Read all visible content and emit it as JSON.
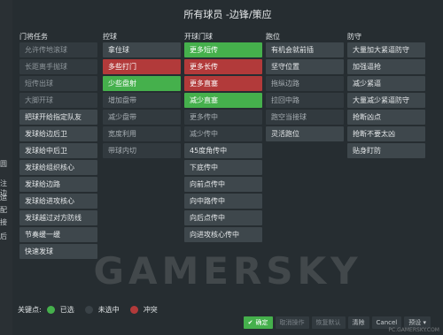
{
  "title": "所有球员 -边锋/策应",
  "left_fragments": [
    "圆",
    "注边",
    "运",
    "配",
    "接",
    "后"
  ],
  "columns": [
    {
      "header": "门将任务",
      "items": [
        {
          "label": "允许传地滚球",
          "state": "off"
        },
        {
          "label": "长距离手抛球",
          "state": "off"
        },
        {
          "label": "短传出球",
          "state": "off"
        },
        {
          "label": "大脚开球",
          "state": "off"
        },
        {
          "label": "把球开给指定队友",
          "state": "on"
        },
        {
          "label": "发球给边后卫",
          "state": "on"
        },
        {
          "label": "发球给中后卫",
          "state": "on"
        },
        {
          "label": "发球给组织核心",
          "state": "on"
        },
        {
          "label": "发球给边路",
          "state": "on"
        },
        {
          "label": "发球给进攻核心",
          "state": "on"
        },
        {
          "label": "发球越过对方防线",
          "state": "on"
        },
        {
          "label": "节奏缓一缓",
          "state": "on"
        },
        {
          "label": "快速发球",
          "state": "on"
        }
      ]
    },
    {
      "header": "控球",
      "items": [
        {
          "label": "拿住球",
          "state": "on"
        },
        {
          "label": "多些打门",
          "state": "red"
        },
        {
          "label": "少些盘射",
          "state": "green"
        },
        {
          "label": "增加盘带",
          "state": "off"
        },
        {
          "label": "减少盘带",
          "state": "off"
        },
        {
          "label": "宽度利用",
          "state": "off"
        },
        {
          "label": "带球内切",
          "state": "off"
        }
      ]
    },
    {
      "header": "开球门球",
      "items": [
        {
          "label": "更多短传",
          "state": "green"
        },
        {
          "label": "更多长传",
          "state": "red"
        },
        {
          "label": "更多直塞",
          "state": "red"
        },
        {
          "label": "减少直塞",
          "state": "green"
        },
        {
          "label": "更多传中",
          "state": "off"
        },
        {
          "label": "减少传中",
          "state": "off"
        },
        {
          "label": "45度角传中",
          "state": "on"
        },
        {
          "label": "下底传中",
          "state": "on"
        },
        {
          "label": "向前点传中",
          "state": "on"
        },
        {
          "label": "向中路传中",
          "state": "on"
        },
        {
          "label": "向后点传中",
          "state": "on"
        },
        {
          "label": "向进攻核心传中",
          "state": "on"
        }
      ]
    },
    {
      "header": "跑位",
      "items": [
        {
          "label": "有机会就前插",
          "state": "on"
        },
        {
          "label": "坚守位置",
          "state": "on"
        },
        {
          "label": "拖纵边路",
          "state": "off"
        },
        {
          "label": "拉回中路",
          "state": "off"
        },
        {
          "label": "跑空当接球",
          "state": "off"
        },
        {
          "label": "灵活跑位",
          "state": "on"
        }
      ]
    },
    {
      "header": "防守",
      "items": [
        {
          "label": "大量加大紧逼防守",
          "state": "on"
        },
        {
          "label": "加强逼抢",
          "state": "on"
        },
        {
          "label": "减少紧逼",
          "state": "on"
        },
        {
          "label": "大量减少紧逼防守",
          "state": "on"
        },
        {
          "label": "抢断凶点",
          "state": "on"
        },
        {
          "label": "抢断不要太凶",
          "state": "on"
        },
        {
          "label": "贴身盯防",
          "state": "on"
        }
      ]
    }
  ],
  "watermark": "GAMERSKY",
  "legend": {
    "label": "关键点:",
    "items": [
      {
        "label": "已选",
        "color": "#45b04c"
      },
      {
        "label": "未选中",
        "color": "#3a4247"
      },
      {
        "label": "冲突",
        "color": "#b23a3a"
      }
    ]
  },
  "footer": {
    "confirm": "确定",
    "undo": "取消操作",
    "restore": "恢复默认",
    "clear": "清除",
    "cancel": "Cancel",
    "preset": "预设"
  },
  "corner_watermark": "PC.GAMERSKY.COM"
}
